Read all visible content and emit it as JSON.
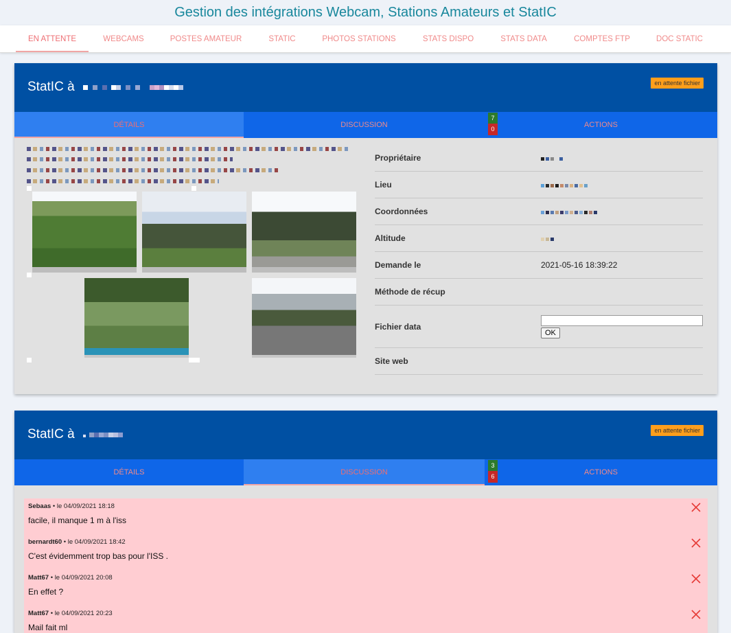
{
  "page": {
    "title": "Gestion des intégrations Webcam, Stations Amateurs et StatIC"
  },
  "nav": {
    "tabs": [
      {
        "label": "EN ATTENTE",
        "active": true
      },
      {
        "label": "WEBCAMS"
      },
      {
        "label": "POSTES AMATEUR"
      },
      {
        "label": "STATIC"
      },
      {
        "label": "PHOTOS STATIONS"
      },
      {
        "label": "STATS DISPO"
      },
      {
        "label": "STATS DATA"
      },
      {
        "label": "COMPTES FTP"
      },
      {
        "label": "DOC STATIC"
      }
    ]
  },
  "cards": [
    {
      "title": "StatIC à",
      "status": "en attente fichier",
      "tabs": {
        "details": "DÉTAILS",
        "discussion": "DISCUSSION",
        "actions": "ACTIONS"
      },
      "active_tab": "details",
      "counts": {
        "green": "7",
        "red": "0"
      },
      "info": {
        "owner_label": "Propriétaire",
        "place_label": "Lieu",
        "coords_label": "Coordonnées",
        "altitude_label": "Altitude",
        "request_label": "Demande le",
        "request_value": "2021-05-16 18:39:22",
        "method_label": "Méthode de récup",
        "datafile_label": "Fichier data",
        "ok_label": "OK",
        "website_label": "Site web"
      }
    },
    {
      "title": "StatIC à",
      "status": "en attente fichier",
      "tabs": {
        "details": "DÉTAILS",
        "discussion": "DISCUSSION",
        "actions": "ACTIONS"
      },
      "active_tab": "discussion",
      "counts": {
        "green": "3",
        "red": "6"
      },
      "messages": [
        {
          "author": "Sebaas",
          "date": "• le 04/09/2021 18:18",
          "text": "facile, il manque 1 m à l'iss"
        },
        {
          "author": "bernardt60",
          "date": "• le 04/09/2021 18:42",
          "text": "C'est évidemment trop bas pour l'ISS ."
        },
        {
          "author": "Matt67",
          "date": "• le 04/09/2021 20:08",
          "text": "En effet ?"
        },
        {
          "author": "Matt67",
          "date": "• le 04/09/2021 20:23",
          "text": "Mail fait ml"
        }
      ]
    }
  ],
  "colors": {
    "header_blue": "#0050a3",
    "tab_blue": "#0f66e8",
    "badge_orange": "#ff9e1b",
    "message_pink": "#ffcdd2"
  }
}
